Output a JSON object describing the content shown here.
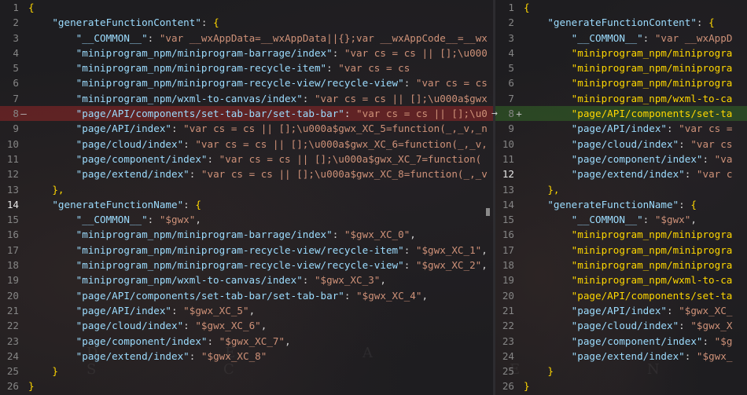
{
  "left": {
    "lines": [
      {
        "n": "1",
        "text": "{"
      },
      {
        "n": "2",
        "text": "    \"generateFunctionContent\": {"
      },
      {
        "n": "3",
        "text": "        \"__COMMON__\": \"var __wxAppData=__wxAppData||{};var __wxAppCode__=__wx"
      },
      {
        "n": "4",
        "text": "        \"miniprogram_npm/miniprogram-barrage/index\": \"var cs = cs || [];\\u000"
      },
      {
        "n": "5",
        "text": "        \"miniprogram_npm/miniprogram-recycle-item\": \"var cs = cs"
      },
      {
        "n": "6",
        "text": "        \"miniprogram_npm/miniprogram-recycle-view/recycle-view\": \"var cs = cs"
      },
      {
        "n": "7",
        "text": "        \"miniprogram_npm/wxml-to-canvas/index\": \"var cs = cs || [];\\u000a$gwx"
      },
      {
        "n": "8",
        "text": "        \"page/API/components/set-tab-bar/set-tab-bar\": \"var cs = cs || [];\\u0"
      },
      {
        "n": "9",
        "text": "        \"page/API/index\": \"var cs = cs || [];\\u000a$gwx_XC_5=function(_,_v,_n"
      },
      {
        "n": "10",
        "text": "        \"page/cloud/index\": \"var cs = cs || [];\\u000a$gwx_XC_6=function(_,_v,"
      },
      {
        "n": "11",
        "text": "        \"page/component/index\": \"var cs = cs || [];\\u000a$gwx_XC_7=function("
      },
      {
        "n": "12",
        "text": "        \"page/extend/index\": \"var cs = cs || [];\\u000a$gwx_XC_8=function(_,_v"
      },
      {
        "n": "13",
        "text": "    },"
      },
      {
        "n": "14",
        "text": "    \"generateFunctionName\": {"
      },
      {
        "n": "15",
        "text": "        \"__COMMON__\": \"$gwx\","
      },
      {
        "n": "16",
        "text": "        \"miniprogram_npm/miniprogram-barrage/index\": \"$gwx_XC_0\","
      },
      {
        "n": "17",
        "text": "        \"miniprogram_npm/miniprogram-recycle-view/recycle-item\": \"$gwx_XC_1\","
      },
      {
        "n": "18",
        "text": "        \"miniprogram_npm/miniprogram-recycle-view/recycle-view\": \"$gwx_XC_2\","
      },
      {
        "n": "19",
        "text": "        \"miniprogram_npm/wxml-to-canvas/index\": \"$gwx_XC_3\","
      },
      {
        "n": "20",
        "text": "        \"page/API/components/set-tab-bar/set-tab-bar\": \"$gwx_XC_4\","
      },
      {
        "n": "21",
        "text": "        \"page/API/index\": \"$gwx_XC_5\","
      },
      {
        "n": "22",
        "text": "        \"page/cloud/index\": \"$gwx_XC_6\","
      },
      {
        "n": "23",
        "text": "        \"page/component/index\": \"$gwx_XC_7\","
      },
      {
        "n": "24",
        "text": "        \"page/extend/index\": \"$gwx_XC_8\""
      },
      {
        "n": "25",
        "text": "    }"
      },
      {
        "n": "26",
        "text": "}"
      }
    ],
    "removed_marker": "—",
    "watermark": "D E A S C"
  },
  "right": {
    "lines": [
      {
        "n": "1",
        "text": "{"
      },
      {
        "n": "2",
        "text": "    \"generateFunctionContent\": {"
      },
      {
        "n": "3",
        "text": "        \"__COMMON__\": \"var __wxAppD"
      },
      {
        "n": "4",
        "text": "        \"miniprogram_npm/miniprogra"
      },
      {
        "n": "5",
        "text": "        \"miniprogram_npm/miniprogra"
      },
      {
        "n": "6",
        "text": "        \"miniprogram_npm/miniprogra"
      },
      {
        "n": "7",
        "text": "        \"miniprogram_npm/wxml-to-ca"
      },
      {
        "n": "8",
        "text": "        \"page/API/components/set-ta"
      },
      {
        "n": "9",
        "text": "        \"page/API/index\": \"var cs ="
      },
      {
        "n": "10",
        "text": "        \"page/cloud/index\": \"var cs"
      },
      {
        "n": "11",
        "text": "        \"page/component/index\": \"va"
      },
      {
        "n": "12",
        "text": "        \"page/extend/index\": \"var c"
      },
      {
        "n": "13",
        "text": "    },"
      },
      {
        "n": "14",
        "text": "    \"generateFunctionName\": {"
      },
      {
        "n": "15",
        "text": "        \"__COMMON__\": \"$gwx\","
      },
      {
        "n": "16",
        "text": "        \"miniprogram_npm/miniprogra"
      },
      {
        "n": "17",
        "text": "        \"miniprogram_npm/miniprogra"
      },
      {
        "n": "18",
        "text": "        \"miniprogram_npm/miniprogra"
      },
      {
        "n": "19",
        "text": "        \"miniprogram_npm/wxml-to-ca"
      },
      {
        "n": "20",
        "text": "        \"page/API/components/set-ta"
      },
      {
        "n": "21",
        "text": "        \"page/API/index\": \"$gwx_XC_"
      },
      {
        "n": "22",
        "text": "        \"page/cloud/index\": \"$gwx_X"
      },
      {
        "n": "23",
        "text": "        \"page/component/index\": \"$g"
      },
      {
        "n": "24",
        "text": "        \"page/extend/index\": \"$gwx_"
      },
      {
        "n": "25",
        "text": "    }"
      },
      {
        "n": "26",
        "text": "}"
      }
    ],
    "added_marker": "+",
    "watermark": "E N"
  },
  "merge_arrow": "→",
  "colors": {
    "key": "#9cdcfe",
    "string": "#ce9178",
    "bracket": "#ffd700",
    "removed_bg": "#aa2828",
    "added_bg": "#377828"
  }
}
